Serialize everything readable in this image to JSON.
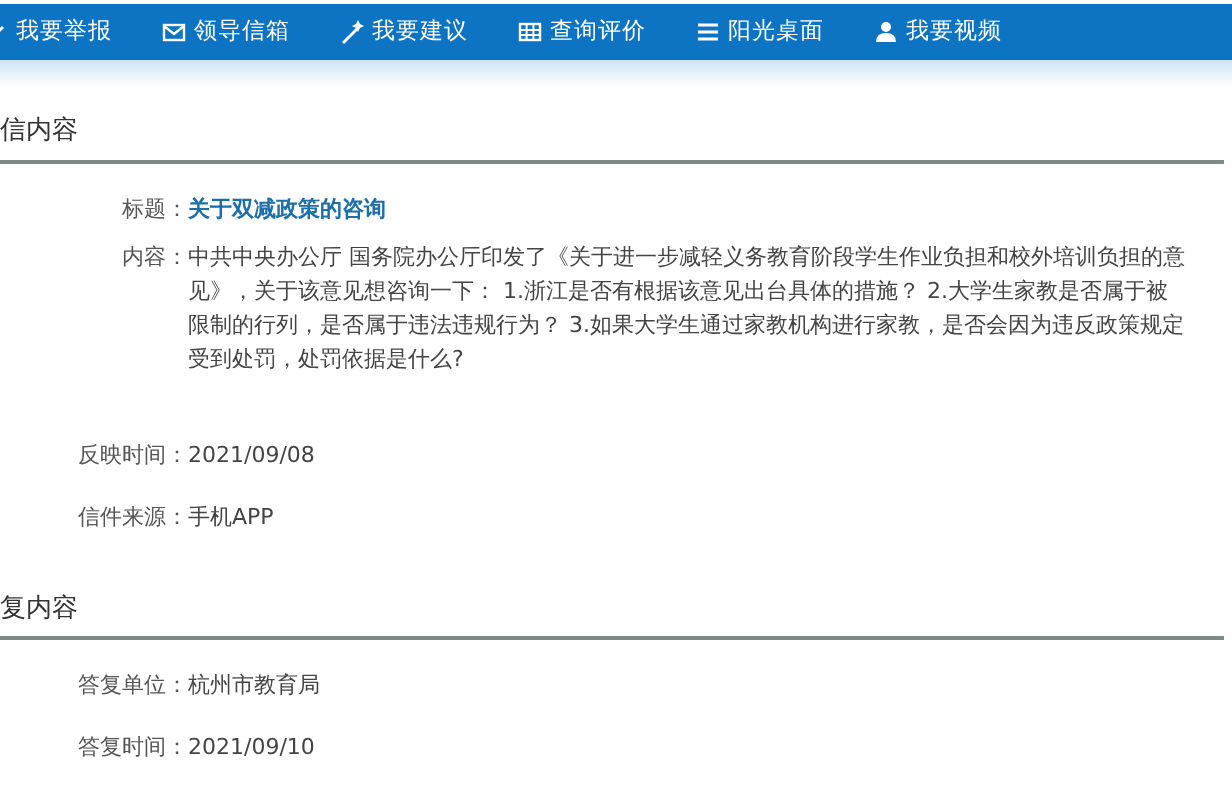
{
  "nav": [
    {
      "label": "我要举报",
      "kind": "report"
    },
    {
      "label": "领导信箱",
      "kind": "mail"
    },
    {
      "label": "我要建议",
      "kind": "suggest"
    },
    {
      "label": "查询评价",
      "kind": "query"
    },
    {
      "label": "阳光桌面",
      "kind": "desk"
    },
    {
      "label": "我要视频",
      "kind": "video"
    }
  ],
  "sections": [
    {
      "heading": "信内容",
      "fields": [
        {
          "label": "标题：",
          "value": "关于双减政策的咨询",
          "kind": "link"
        },
        {
          "label": "内容：",
          "value": "中共中央办公厅 国务院办公厅印发了《关于进一步减轻义务教育阶段学生作业负担和校外培训负担的意见》，关于该意见想咨询一下： 1.浙江是否有根据该意见出台具体的措施？ 2.大学生家教是否属于被限制的行列，是否属于违法违规行为？ 3.如果大学生通过家教机构进行家教，是否会因为违反政策规定受到处罚，处罚依据是什么?",
          "kind": "text"
        },
        {
          "label": "反映时间：",
          "value": "2021/09/08",
          "kind": "text"
        },
        {
          "label": "信件来源：",
          "value": "手机APP",
          "kind": "text"
        }
      ]
    },
    {
      "heading": "复内容",
      "fields": [
        {
          "label": "答复单位：",
          "value": "杭州市教育局",
          "kind": "text"
        },
        {
          "label": "答复时间：",
          "value": "2021/09/10",
          "kind": "text"
        }
      ]
    }
  ]
}
